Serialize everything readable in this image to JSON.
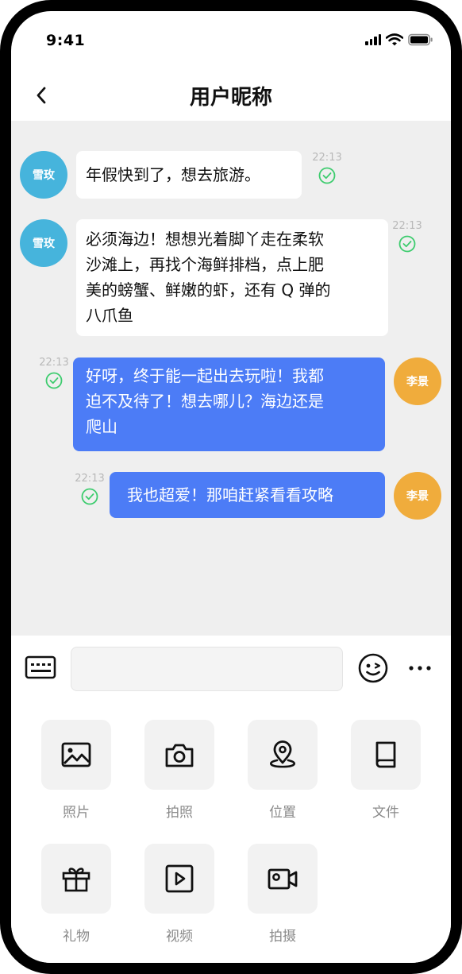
{
  "status_bar": {
    "time": "9:41"
  },
  "header": {
    "title": "用户昵称"
  },
  "messages": [
    {
      "side": "left",
      "avatar": "雪玫",
      "text": "年假快到了，想去旅游。",
      "time": "22:13"
    },
    {
      "side": "left",
      "avatar": "雪玫",
      "lines": [
        "必须海边！想想光着脚丫走在柔软",
        "沙滩上，再找个海鲜排档，点上肥",
        "美的螃蟹、鲜嫩的虾，还有 Q 弹的",
        "八爪鱼"
      ],
      "time": "22:13"
    },
    {
      "side": "right",
      "avatar": "李景",
      "lines": [
        "好呀，终于能一起出去玩啦！我都",
        "迫不及待了！想去哪儿？海边还是",
        "爬山"
      ],
      "time": "22:13"
    },
    {
      "side": "right",
      "avatar": "李景",
      "text": "我也超爱！那咱赶紧看看攻略",
      "time": "22:13"
    }
  ],
  "input": {
    "value": "",
    "placeholder": ""
  },
  "tools": [
    {
      "label": "照片",
      "icon": "image-icon"
    },
    {
      "label": "拍照",
      "icon": "camera-icon"
    },
    {
      "label": "位置",
      "icon": "location-pin-icon"
    },
    {
      "label": "文件",
      "icon": "book-file-icon"
    },
    {
      "label": "礼物",
      "icon": "gift-icon"
    },
    {
      "label": "视频",
      "icon": "video-play-icon"
    },
    {
      "label": "拍摄",
      "icon": "video-camera-icon"
    }
  ],
  "colors": {
    "chat_background": "#efefef",
    "left_bubble": "#ffffff",
    "right_bubble": "#4c7cf6",
    "avatar_left": "#46b4dc",
    "avatar_right": "#f0ac3c",
    "read_check": "#3dcc6e"
  }
}
